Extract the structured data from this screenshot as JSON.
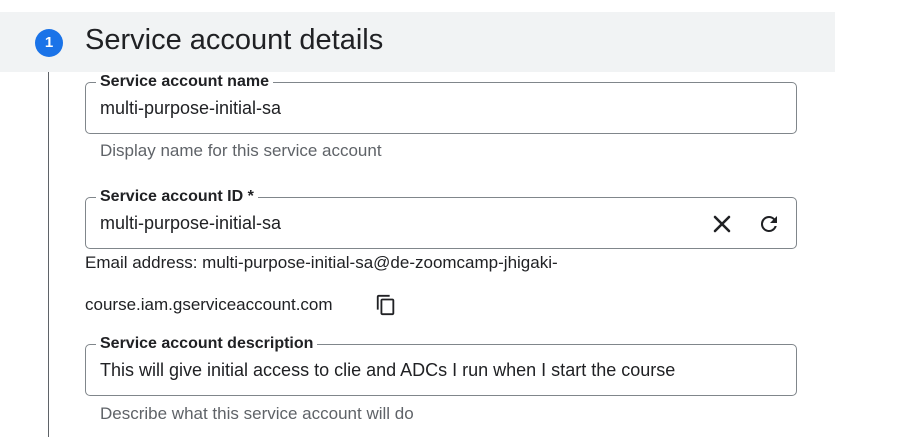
{
  "step": {
    "number": "1",
    "title": "Service account details"
  },
  "fields": {
    "name": {
      "label": "Service account name",
      "value": "multi-purpose-initial-sa",
      "hint": "Display name for this service account"
    },
    "id": {
      "label": "Service account ID *",
      "value": "multi-purpose-initial-sa",
      "email_line1": "Email address: multi-purpose-initial-sa@de-zoomcamp-jhigaki-",
      "email_line2": "course.iam.gserviceaccount.com"
    },
    "description": {
      "label": "Service account description",
      "value": "This will give initial access to clie and ADCs I run when I start the course",
      "hint": "Describe what this service account will do"
    }
  },
  "icons": {
    "clear": "close-icon",
    "regenerate": "refresh-icon",
    "copy": "copy-icon"
  },
  "colors": {
    "accent": "#1a73e8",
    "header_bg": "#f1f3f4",
    "border": "#80868b",
    "hint_text": "#5f6368"
  }
}
